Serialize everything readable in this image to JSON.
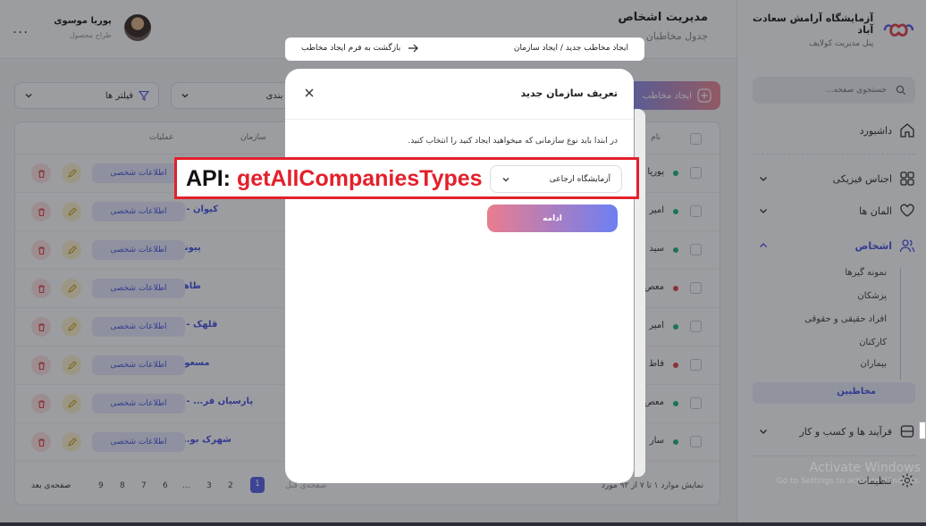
{
  "sidebar": {
    "brand": {
      "title": "آزمایشگاه آرامش سعادت آباد",
      "subtitle": "پنل مدیریت کولایف"
    },
    "search_placeholder": "جستجوی صفحه...",
    "items": [
      {
        "label": "داشبورد"
      },
      {
        "label": "اجناس فیزیکی"
      },
      {
        "label": "المان ها"
      },
      {
        "label": "اشخاص"
      },
      {
        "label": "فرآیند ها و کسب و کار"
      },
      {
        "label": "تنظیمات"
      }
    ],
    "sub_items": [
      {
        "label": "نمونه گیرها"
      },
      {
        "label": "پزشکان"
      },
      {
        "label": "افراد حقیقی و حقوقی"
      },
      {
        "label": "کارکنان"
      },
      {
        "label": "بیماران"
      },
      {
        "label": "مخاطبین"
      }
    ]
  },
  "header": {
    "title": "مدیریت اشخاص",
    "subtitle": "جدول مخاطبان",
    "user": {
      "name": "پوریا موسوی",
      "role": "طراح محصول"
    },
    "more": "..."
  },
  "toolbar": {
    "filters_label": "فیلتر ها",
    "group_label": "گروه بندی",
    "create_label": "ایجاد مخاطب"
  },
  "table": {
    "columns": {
      "name": "نام",
      "org": "سازمان",
      "actions": "عملیات"
    },
    "info_label": "اطلاعات شخصی",
    "rows": [
      {
        "name": "پوریا",
        "org": "",
        "status": "#25b77a"
      },
      {
        "name": "امیر",
        "org": "کیوان - ش.ک",
        "status": "#25b77a"
      },
      {
        "name": "سید",
        "org": "پیوند - ا.ر",
        "status": "#25b77a"
      },
      {
        "name": "معص",
        "org": "طاها - ا.ر",
        "status": "#e0464e"
      },
      {
        "name": "امیر",
        "org": "قلهک - ش.ک",
        "status": "#25b77a"
      },
      {
        "name": "فاط",
        "org": "مسعود - ا.ر",
        "status": "#e0464e"
      },
      {
        "name": "معص",
        "org": "پارسیان فر... - ش.ک",
        "status": "#25b77a"
      },
      {
        "name": "سار",
        "org": "شهرک بو... - ا.ر",
        "status": "#25b77a"
      }
    ],
    "pager": {
      "next_label": "صفحه‌ی بعد",
      "prev_label": "صفحه‌ی قبل",
      "pages": [
        "9",
        "8",
        "7",
        "6",
        "...",
        "3",
        "2",
        "1"
      ],
      "current": "1",
      "summary": "نمایش موارد ۱ تا ۷ از ۹۲ مورد"
    }
  },
  "breadcrumb_bar": {
    "path": "ایجاد مخاطب جدید / ایجاد سازمان",
    "back_label": "بازگشت به فرم ایجاد مخاطب"
  },
  "modal": {
    "title": "تعریف سازمان جدید",
    "description": "در ابتدا باید نوع سازمانی که میخواهید ایجاد کنید را انتخاب کنید.",
    "select_value": "آزمایشگاه ارجاعی",
    "continue_label": "ادامه"
  },
  "annotation": {
    "prefix": "API: ",
    "api_name": "getAllCompaniesTypes"
  },
  "watermark": {
    "line1": "Activate Windows",
    "line2": "Go to Settings to activate Windows."
  },
  "colors": {
    "accent": "#4a56e2",
    "danger": "#e3202b",
    "success": "#25b77a"
  }
}
